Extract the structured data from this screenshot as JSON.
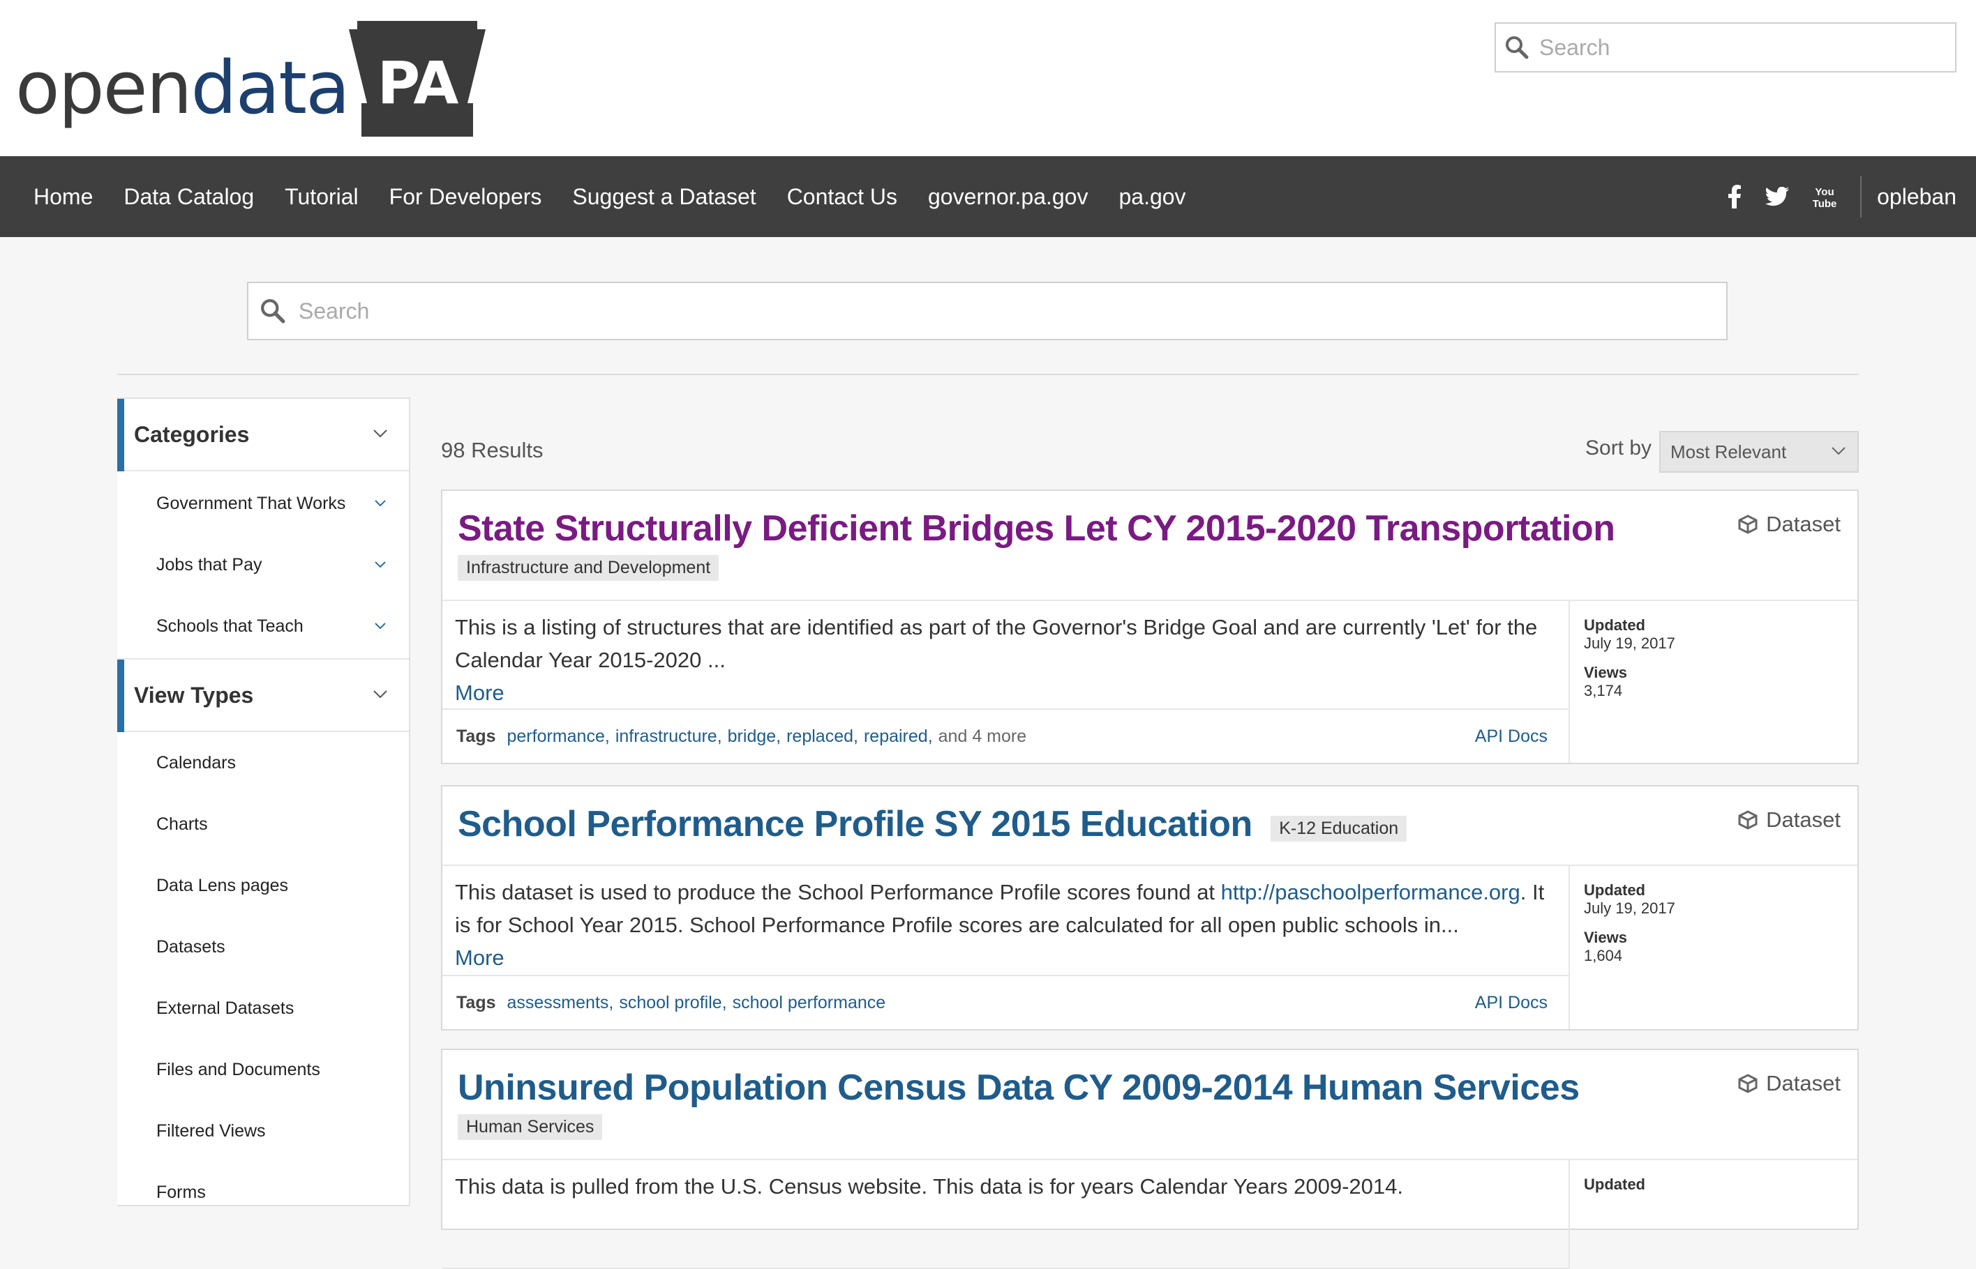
{
  "header": {
    "logo_open": "open",
    "logo_data": "data",
    "logo_pa": "PA",
    "search_placeholder": "Search"
  },
  "nav": {
    "links": [
      "Home",
      "Data Catalog",
      "Tutorial",
      "For Developers",
      "Suggest a Dataset",
      "Contact Us",
      "governor.pa.gov",
      "pa.gov"
    ],
    "social_icons": [
      "facebook-icon",
      "twitter-icon",
      "youtube-icon"
    ],
    "user": "opleban"
  },
  "main_search": {
    "placeholder": "Search"
  },
  "sidebar": {
    "categories": {
      "title": "Categories",
      "items": [
        "Government That Works",
        "Jobs that Pay",
        "Schools that Teach"
      ]
    },
    "view_types": {
      "title": "View Types",
      "items": [
        "Calendars",
        "Charts",
        "Data Lens pages",
        "Datasets",
        "External Datasets",
        "Files and Documents",
        "Filtered Views",
        "Forms"
      ]
    }
  },
  "results": {
    "count": "98 Results",
    "sort_label": "Sort by",
    "sort_value": "Most Relevant",
    "cards": [
      {
        "title": "State Structurally Deficient Bridges Let CY 2015-2020 Transportation",
        "category": "Infrastructure and Development",
        "type": "Dataset",
        "description": "This is a listing of structures that are identified as part of the Governor's Bridge Goal and are currently 'Let' for the Calendar Year 2015-2020 ...",
        "more": "More",
        "tags_label": "Tags",
        "tags": [
          "performance",
          "infrastructure",
          "bridge",
          "replaced",
          "repaired"
        ],
        "and_more": "and 4 more",
        "api_docs": "API Docs",
        "updated_label": "Updated",
        "updated": "July 19, 2017",
        "views_label": "Views",
        "views": "3,174"
      },
      {
        "title": "School Performance Profile SY 2015 Education",
        "category": "K-12 Education",
        "type": "Dataset",
        "description_pre": "This dataset is used to produce the School Performance Profile scores found at ",
        "description_link": "http://paschoolperformance.org",
        "description_post": ". It is for School Year 2015. School Performance Profile scores are calculated for all open public schools in...",
        "more": "More",
        "tags_label": "Tags",
        "tags": [
          "assessments",
          "school profile",
          "school performance"
        ],
        "api_docs": "API Docs",
        "updated_label": "Updated",
        "updated": "July 19, 2017",
        "views_label": "Views",
        "views": "1,604"
      },
      {
        "title": "Uninsured Population Census Data CY 2009-2014 Human Services",
        "category": "Human Services",
        "type": "Dataset",
        "description": "This data is pulled from the U.S. Census website. This data is for years Calendar Years 2009-2014.",
        "updated_label": "Updated"
      }
    ]
  }
}
